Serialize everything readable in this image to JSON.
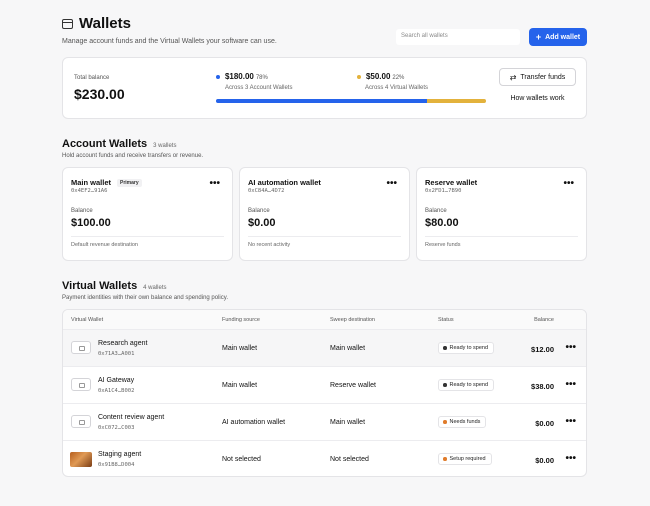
{
  "header": {
    "title": "Wallets",
    "subtitle": "Manage account funds and the Virtual Wallets your software can use.",
    "search_placeholder": "Search all wallets",
    "add_button": "Add wallet"
  },
  "balance": {
    "label": "Total balance",
    "value": "$230.00",
    "accounts": {
      "amount": "$180.00",
      "percent": "78%",
      "sub": "Across 3 Account Wallets",
      "color": "#2563eb",
      "share": 0.78
    },
    "virtual": {
      "amount": "$50.00",
      "percent": "22%",
      "sub": "Across 4 Virtual Wallets",
      "color": "#e3b23c",
      "share": 0.22
    },
    "transfer_button": "Transfer funds",
    "how_link": "How wallets work"
  },
  "account_section": {
    "title": "Account Wallets",
    "count": "3 wallets",
    "description": "Hold account funds and receive transfers or revenue.",
    "balance_label": "Balance",
    "cards": [
      {
        "name": "Main wallet",
        "badge": "Primary",
        "id": "0x4EF2…91A6",
        "balance": "$100.00",
        "footer": "Default revenue destination"
      },
      {
        "name": "AI automation wallet",
        "badge": "",
        "id": "0xC84A…4D72",
        "balance": "$0.00",
        "footer": "No recent activity"
      },
      {
        "name": "Reserve wallet",
        "badge": "",
        "id": "0x2FD1…7B90",
        "balance": "$80.00",
        "footer": "Reserve funds"
      }
    ]
  },
  "virtual_section": {
    "title": "Virtual Wallets",
    "count": "4 wallets",
    "description": "Payment identities with their own balance and spending policy.",
    "columns": [
      "Virtual Wallet",
      "Funding source",
      "Sweep destination",
      "Status",
      "Balance"
    ],
    "rows": [
      {
        "name": "Research agent",
        "id": "0x71A3…A001",
        "funding": "Main wallet",
        "sweep": "Main wallet",
        "status": "Ready to spend",
        "status_color": "#333333",
        "balance": "$12.00",
        "icon": "wallet-icon"
      },
      {
        "name": "AI Gateway",
        "id": "0xA1C4…B002",
        "funding": "Main wallet",
        "sweep": "Reserve wallet",
        "status": "Ready to spend",
        "status_color": "#333333",
        "balance": "$38.00",
        "icon": "wallet-icon"
      },
      {
        "name": "Content review agent",
        "id": "0xC072…C003",
        "funding": "AI automation wallet",
        "sweep": "Main wallet",
        "status": "Needs funds",
        "status_color": "#e07b2a",
        "balance": "$0.00",
        "icon": "wallet-icon"
      },
      {
        "name": "Staging agent",
        "id": "0x91B8…D004",
        "funding": "Not selected",
        "sweep": "Not selected",
        "status": "Setup required",
        "status_color": "#e07b2a",
        "balance": "$0.00",
        "icon": "avatar-image"
      }
    ]
  },
  "more_menu": "•••"
}
